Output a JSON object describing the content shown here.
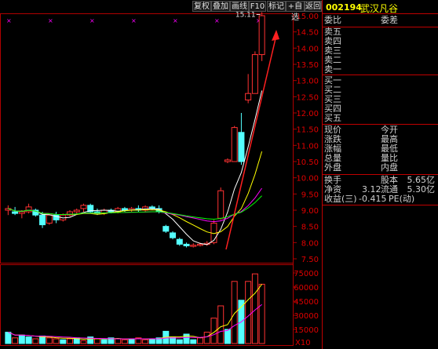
{
  "toolbar": {
    "buttons": [
      "复权",
      "叠加",
      "画线",
      "F10",
      "标记",
      "+自选",
      "返回"
    ]
  },
  "stock": {
    "code": "002194",
    "name": "武汉凡谷"
  },
  "panel": {
    "weibi_label": "委比",
    "weicha_label": "委差",
    "sell": [
      "卖五",
      "卖四",
      "卖三",
      "卖二",
      "卖一"
    ],
    "buy": [
      "买一",
      "买二",
      "买三",
      "买四",
      "买五"
    ],
    "quote_rows": [
      {
        "l1": "现价",
        "l2": "今开"
      },
      {
        "l1": "涨跌",
        "l2": "最高"
      },
      {
        "l1": "涨幅",
        "l2": "最低"
      },
      {
        "l1": "总量",
        "l2": "量比"
      },
      {
        "l1": "外盘",
        "l2": "内盘"
      }
    ],
    "fund_rows": [
      {
        "l1": "换手",
        "v1": "",
        "l2": "股本",
        "v2": "5.65亿"
      },
      {
        "l1": "净资",
        "v1": "3.12",
        "l2": "流通",
        "v2": "5.30亿"
      },
      {
        "l1": "收益(三)",
        "v1": "-0.415",
        "l2": "PE(动)",
        "v2": ""
      }
    ]
  },
  "chart_data": {
    "type": "candlestick",
    "price_axis": {
      "ticks": [
        "15.00",
        "14.50",
        "14.00",
        "13.50",
        "13.00",
        "12.50",
        "12.00",
        "11.50",
        "11.00",
        "10.50",
        "10.00",
        "9.50",
        "9.00",
        "8.50",
        "8.00",
        "7.50"
      ],
      "range": [
        7.5,
        15.0
      ]
    },
    "volume_axis": {
      "ticks": [
        "75000",
        "60000",
        "45000",
        "30000",
        "15000"
      ],
      "range": [
        0,
        75000
      ],
      "unit_label": "X10"
    },
    "high_marker": "15.11",
    "colors": {
      "up": "#ff3232",
      "down": "#54ffff",
      "ma5": "#ffffff",
      "ma10": "#ffff00",
      "ma20": "#ff00ff",
      "ma30": "#00ff00",
      "grid": "#b00000"
    },
    "candles": [
      {
        "o": 9.0,
        "h": 9.15,
        "l": 8.85,
        "c": 9.05
      },
      {
        "o": 8.95,
        "h": 9.1,
        "l": 8.85,
        "c": 8.9
      },
      {
        "o": 8.9,
        "h": 9.0,
        "l": 8.75,
        "c": 8.95
      },
      {
        "o": 8.95,
        "h": 9.2,
        "l": 8.9,
        "c": 9.1
      },
      {
        "o": 9.0,
        "h": 9.05,
        "l": 8.8,
        "c": 8.85
      },
      {
        "o": 8.85,
        "h": 8.95,
        "l": 8.45,
        "c": 8.55
      },
      {
        "o": 8.6,
        "h": 8.9,
        "l": 8.55,
        "c": 8.85
      },
      {
        "o": 8.85,
        "h": 8.95,
        "l": 8.6,
        "c": 8.7
      },
      {
        "o": 8.7,
        "h": 8.9,
        "l": 8.65,
        "c": 8.85
      },
      {
        "o": 8.85,
        "h": 9.0,
        "l": 8.8,
        "c": 8.95
      },
      {
        "o": 8.95,
        "h": 9.05,
        "l": 8.85,
        "c": 9.0
      },
      {
        "o": 9.05,
        "h": 9.2,
        "l": 8.95,
        "c": 9.15
      },
      {
        "o": 9.15,
        "h": 9.2,
        "l": 8.9,
        "c": 8.95
      },
      {
        "o": 8.95,
        "h": 9.05,
        "l": 8.85,
        "c": 8.9
      },
      {
        "o": 8.9,
        "h": 9.05,
        "l": 8.85,
        "c": 9.0
      },
      {
        "o": 9.0,
        "h": 9.05,
        "l": 8.9,
        "c": 8.95
      },
      {
        "o": 8.95,
        "h": 9.1,
        "l": 8.9,
        "c": 9.05
      },
      {
        "o": 9.05,
        "h": 9.1,
        "l": 8.95,
        "c": 9.0
      },
      {
        "o": 9.0,
        "h": 9.1,
        "l": 8.95,
        "c": 9.05
      },
      {
        "o": 9.05,
        "h": 9.15,
        "l": 8.95,
        "c": 9.0
      },
      {
        "o": 9.0,
        "h": 9.15,
        "l": 8.95,
        "c": 9.1
      },
      {
        "o": 9.1,
        "h": 9.15,
        "l": 9.0,
        "c": 9.05
      },
      {
        "o": 9.05,
        "h": 9.15,
        "l": 8.9,
        "c": 8.95
      },
      {
        "o": 8.5,
        "h": 8.55,
        "l": 8.3,
        "c": 8.35
      },
      {
        "o": 8.3,
        "h": 8.35,
        "l": 8.1,
        "c": 8.15
      },
      {
        "o": 8.1,
        "h": 8.15,
        "l": 7.9,
        "c": 7.95
      },
      {
        "o": 7.95,
        "h": 8.0,
        "l": 7.85,
        "c": 7.9
      },
      {
        "o": 7.9,
        "h": 7.98,
        "l": 7.85,
        "c": 7.92
      },
      {
        "o": 7.92,
        "h": 8.0,
        "l": 7.88,
        "c": 7.95
      },
      {
        "o": 7.95,
        "h": 8.05,
        "l": 7.9,
        "c": 7.98
      },
      {
        "o": 8.0,
        "h": 8.7,
        "l": 7.95,
        "c": 8.6
      },
      {
        "o": 8.75,
        "h": 9.7,
        "l": 8.7,
        "c": 9.6
      },
      {
        "o": 10.5,
        "h": 10.6,
        "l": 10.45,
        "c": 10.55
      },
      {
        "o": 10.5,
        "h": 11.6,
        "l": 10.5,
        "c": 11.55
      },
      {
        "o": 11.4,
        "h": 12.0,
        "l": 10.4,
        "c": 10.5
      },
      {
        "o": 12.4,
        "h": 13.2,
        "l": 12.3,
        "c": 12.6
      },
      {
        "o": 12.6,
        "h": 13.9,
        "l": 12.6,
        "c": 13.8
      },
      {
        "o": 13.8,
        "h": 15.11,
        "l": 13.6,
        "c": 15.0
      }
    ],
    "volumes": [
      {
        "v": 12000,
        "up": false
      },
      {
        "v": 6000,
        "up": true
      },
      {
        "v": 9000,
        "up": false
      },
      {
        "v": 7000,
        "up": false
      },
      {
        "v": 5000,
        "up": true
      },
      {
        "v": 8000,
        "up": false
      },
      {
        "v": 6000,
        "up": true
      },
      {
        "v": 5000,
        "up": true
      },
      {
        "v": 4000,
        "up": false
      },
      {
        "v": 5000,
        "up": true
      },
      {
        "v": 6000,
        "up": false
      },
      {
        "v": 3000,
        "up": true
      },
      {
        "v": 7000,
        "up": false
      },
      {
        "v": 5000,
        "up": true
      },
      {
        "v": 4000,
        "up": false
      },
      {
        "v": 6000,
        "up": false
      },
      {
        "v": 5000,
        "up": true
      },
      {
        "v": 4000,
        "up": true
      },
      {
        "v": 5000,
        "up": false
      },
      {
        "v": 6000,
        "up": true
      },
      {
        "v": 4000,
        "up": true
      },
      {
        "v": 5000,
        "up": false
      },
      {
        "v": 6000,
        "up": false
      },
      {
        "v": 13000,
        "up": false
      },
      {
        "v": 7000,
        "up": false
      },
      {
        "v": 4000,
        "up": false
      },
      {
        "v": 10000,
        "up": false
      },
      {
        "v": 4000,
        "up": false
      },
      {
        "v": 6000,
        "up": true
      },
      {
        "v": 12000,
        "up": true
      },
      {
        "v": 27000,
        "up": true
      },
      {
        "v": 40000,
        "up": true
      },
      {
        "v": 15000,
        "up": false
      },
      {
        "v": 66000,
        "up": true
      },
      {
        "v": 46000,
        "up": false
      },
      {
        "v": 66000,
        "up": true
      },
      {
        "v": 74000,
        "up": true
      },
      {
        "v": 63000,
        "up": true
      }
    ]
  }
}
